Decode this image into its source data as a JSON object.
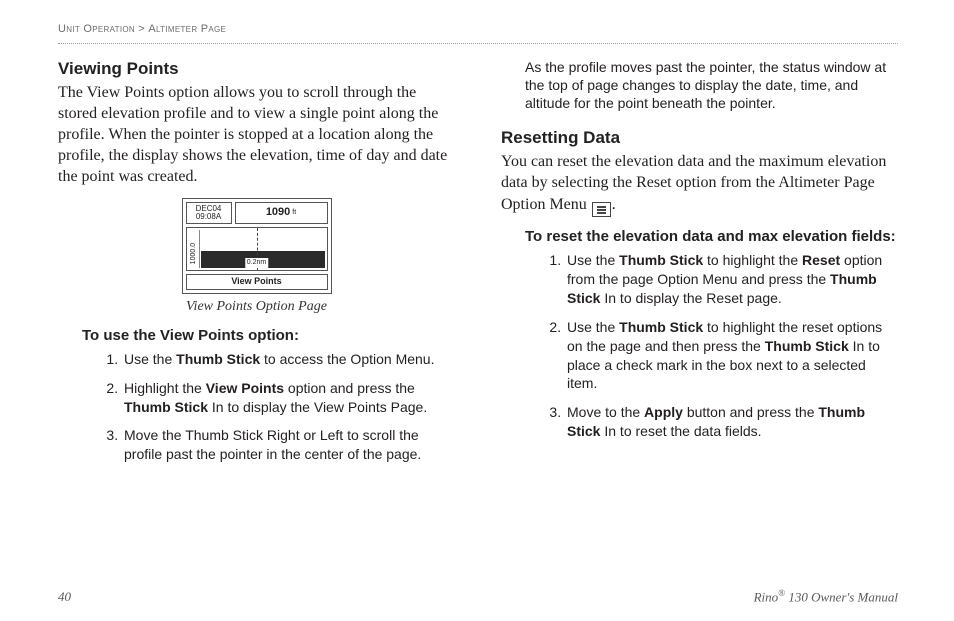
{
  "breadcrumb": {
    "a": "Unit Operation",
    "sep": " > ",
    "b": "Altimeter Page"
  },
  "left": {
    "h": "Viewing Points",
    "p": "The View Points option allows you to scroll through the stored elevation profile and to view a single point along the profile. When the pointer is stopped at a location along the profile, the display shows the elevation, time of day and date the point was created.",
    "fig": {
      "date1": "DEC04",
      "date2": "09:08A",
      "elev": "1090",
      "unit": "ft",
      "ylabel": "1000.0",
      "xlabel": "0.2nm",
      "tab": "View Points",
      "caption": "View Points Option Page"
    },
    "sub": "To use the View Points option:",
    "steps": [
      {
        "pre": "Use the ",
        "b1": "Thumb Stick",
        "post": " to access the Option Menu."
      },
      {
        "pre": "Highlight the ",
        "b1": "View Points",
        "mid": " option and press the ",
        "b2": "Thumb Stick",
        "post": " In to display the View Points Page."
      },
      {
        "plain": "Move the Thumb Stick Right or Left to scroll the profile past the pointer in the center of the page."
      }
    ]
  },
  "right": {
    "lead": "As the profile moves past the pointer, the status window at the top of page changes to display the date, time, and altitude for the point beneath the pointer.",
    "h": "Resetting Data",
    "p_a": "You can reset the elevation data and the maximum elevation data by selecting the Reset option from the Altimeter Page Option Menu ",
    "p_b": ".",
    "sub": "To reset the elevation data and max elevation fields:",
    "steps": [
      {
        "pre": "Use the ",
        "b1": "Thumb Stick",
        "mid": " to highlight the ",
        "b2": "Reset",
        "mid2": " option from the page Option Menu and press the ",
        "b3": "Thumb Stick",
        "post": " In to display the Reset page."
      },
      {
        "pre": "Use the ",
        "b1": "Thumb Stick",
        "mid": " to highlight the reset options on the page and then press the ",
        "b2": "Thumb Stick",
        "post": " In to place a check mark in the box next to a selected item."
      },
      {
        "pre": "Move to the ",
        "b1": "Apply",
        "mid": " button and press the ",
        "b2": "Thumb Stick",
        "post": " In to reset the data fields."
      }
    ]
  },
  "footer": {
    "page": "40",
    "book_a": "Rino",
    "book_sup": "®",
    "book_b": " 130 Owner's Manual"
  }
}
